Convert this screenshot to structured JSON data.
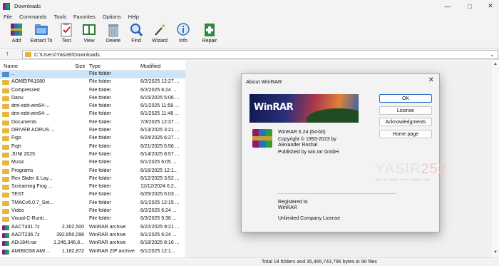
{
  "window": {
    "title": "Downloads"
  },
  "menu": [
    "File",
    "Commands",
    "Tools",
    "Favorites",
    "Options",
    "Help"
  ],
  "toolbar": [
    {
      "label": "Add",
      "icon": "add-archive-icon"
    },
    {
      "label": "Extract To",
      "icon": "extract-folder-icon"
    },
    {
      "label": "Test",
      "icon": "test-clipboard-icon"
    },
    {
      "label": "View",
      "icon": "view-book-icon"
    },
    {
      "label": "Delete",
      "icon": "trash-icon"
    },
    {
      "label": "Find",
      "icon": "magnifier-icon"
    },
    {
      "label": "Wizard",
      "icon": "magic-wand-icon"
    },
    {
      "label": "Info",
      "icon": "info-icon"
    },
    {
      "label": "Repair",
      "icon": "repair-kit-icon"
    }
  ],
  "address": {
    "path": "C:\\Users\\YasirB\\Downloads"
  },
  "columns": {
    "name": "Name",
    "size": "Size",
    "type": "Type",
    "modified": "Modified"
  },
  "files": [
    {
      "name": "..",
      "size": "",
      "type": "File folder",
      "modified": "",
      "kind": "up"
    },
    {
      "name": "AOMEIPA1080",
      "size": "",
      "type": "File folder",
      "modified": "6/2/2025 12:27 ...",
      "kind": "folder"
    },
    {
      "name": "Compressed",
      "size": "",
      "type": "File folder",
      "modified": "6/2/2025 6:24 ...",
      "kind": "folder"
    },
    {
      "name": "Danu",
      "size": "",
      "type": "File folder",
      "modified": "6/15/2025 5:06 ...",
      "kind": "folder"
    },
    {
      "name": "dmi-edit-win64-...",
      "size": "",
      "type": "File folder",
      "modified": "6/1/2025 11:58 ...",
      "kind": "folder"
    },
    {
      "name": "dmi-edit-win64-...",
      "size": "",
      "type": "File folder",
      "modified": "6/1/2025 11:48 ...",
      "kind": "folder"
    },
    {
      "name": "Documents",
      "size": "",
      "type": "File folder",
      "modified": "7/3/2025 12:37 ...",
      "kind": "folder"
    },
    {
      "name": "DRIVER AORUS ...",
      "size": "",
      "type": "File folder",
      "modified": "6/13/2025 3:21 ...",
      "kind": "folder"
    },
    {
      "name": "Figo",
      "size": "",
      "type": "File folder",
      "modified": "6/24/2025 6:27 ...",
      "kind": "folder"
    },
    {
      "name": "Fiqh",
      "size": "",
      "type": "File folder",
      "modified": "6/21/2025 5:56 ...",
      "kind": "folder"
    },
    {
      "name": "JUNI 2025",
      "size": "",
      "type": "File folder",
      "modified": "6/14/2025 8:57 ...",
      "kind": "folder"
    },
    {
      "name": "Music",
      "size": "",
      "type": "File folder",
      "modified": "6/1/2025 6:05 ...",
      "kind": "folder"
    },
    {
      "name": "Programs",
      "size": "",
      "type": "File folder",
      "modified": "6/16/2025 12:1...",
      "kind": "folder"
    },
    {
      "name": "Rev Slider & Lay...",
      "size": "",
      "type": "File folder",
      "modified": "6/12/2025 3:52 ...",
      "kind": "folder"
    },
    {
      "name": "Screaming Frog ...",
      "size": "",
      "type": "File folder",
      "modified": "12/12/2024 6:2...",
      "kind": "folder"
    },
    {
      "name": "TEST",
      "size": "",
      "type": "File folder",
      "modified": "6/25/2025 5:03 ...",
      "kind": "folder"
    },
    {
      "name": "TMACv6.0.7_Set...",
      "size": "",
      "type": "File folder",
      "modified": "6/1/2025 12:15 ...",
      "kind": "folder"
    },
    {
      "name": "Video",
      "size": "",
      "type": "File folder",
      "modified": "6/2/2025 6:24 ...",
      "kind": "folder"
    },
    {
      "name": "Visual-C-Runti...",
      "size": "",
      "type": "File folder",
      "modified": "6/3/2025 9:36 ...",
      "kind": "folder"
    },
    {
      "name": "AACT431.7z",
      "size": "2,302,500",
      "type": "WinRAR archive",
      "modified": "6/22/2025 9:21 ...",
      "kind": "archive"
    },
    {
      "name": "AADT236.7z",
      "size": "392,850,098",
      "type": "WinRAR archive",
      "modified": "6/1/2025 6:24 ...",
      "kind": "archive"
    },
    {
      "name": "ADi184f.rar",
      "size": "1,246,346,8...",
      "type": "WinRAR archive",
      "modified": "6/18/2025 8:16 ...",
      "kind": "archive"
    },
    {
      "name": "AMIBIOS8 AMI ...",
      "size": "1,182,872",
      "type": "WinRAR ZIP archive",
      "modified": "6/1/2025 12:1...",
      "kind": "archive"
    }
  ],
  "status": {
    "text": "Total 18 folders and 35,465,743,796 bytes in 90 files"
  },
  "about": {
    "title": "About WinRAR",
    "banner_text": "WinRAR",
    "version": "WinRAR 6.24 (64-bit)",
    "copyright": "Copyright © 1993-2023 by",
    "author": "Alexander Roshal",
    "publisher": "Published by win.rar GmbH",
    "registered_to_label": "Registered to",
    "registered_to": "WinRAR",
    "license": "Unlimited Company License",
    "buttons": {
      "ok": "OK",
      "license": "License",
      "acknowledgments": "Acknowledgments",
      "homepage": "Home page"
    },
    "watermark": {
      "word": "YASIR",
      "number": "252",
      "tagline": "Tips, Trik, Games, Tutorial, Software, Tools"
    }
  }
}
